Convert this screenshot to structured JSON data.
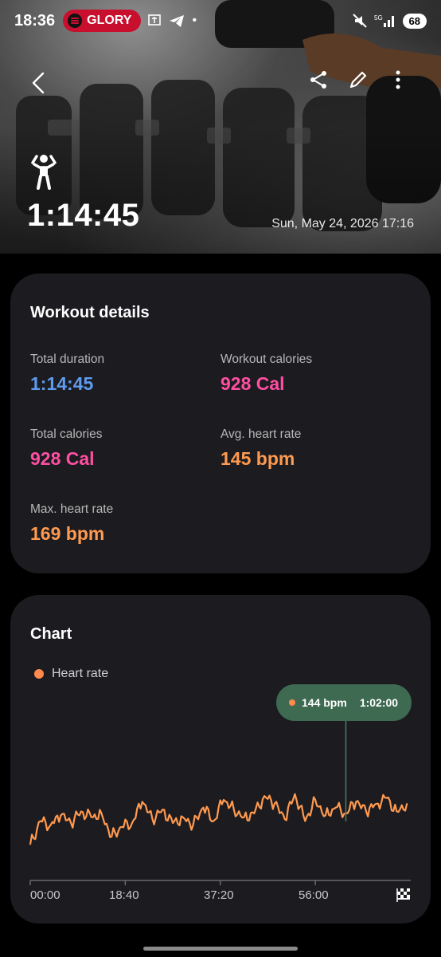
{
  "status_bar": {
    "time": "18:36",
    "spotify_label": "GLORY",
    "battery": "68"
  },
  "header": {
    "duration": "1:14:45",
    "date": "Sun, May 24, 2026 17:16"
  },
  "details": {
    "title": "Workout details",
    "stats": [
      {
        "label": "Total duration",
        "value": "1:14:45"
      },
      {
        "label": "Workout calories",
        "value": "928 Cal"
      },
      {
        "label": "Total calories",
        "value": "928 Cal"
      },
      {
        "label": "Avg. heart rate",
        "value": "145 bpm"
      },
      {
        "label": "Max. heart rate",
        "value": "169 bpm"
      }
    ]
  },
  "chart": {
    "title": "Chart",
    "legend": "Heart rate",
    "tooltip_value": "144 bpm",
    "tooltip_time": "1:02:00"
  },
  "colors": {
    "duration_blue": "#5e9bf0",
    "calories_pink": "#ff4fa3",
    "heart_orange": "#ff9a50",
    "tooltip_green": "#3e6a52",
    "card_bg": "#1c1b1f"
  },
  "chart_data": {
    "type": "line",
    "xlabel": "",
    "ylabel": "",
    "x_ticks": [
      "00:00",
      "18:40",
      "37:20",
      "56:00"
    ],
    "series": [
      {
        "name": "Heart rate",
        "x_minutes": [
          0,
          2,
          4,
          6,
          8,
          10,
          12,
          14,
          16,
          18,
          20,
          22,
          24,
          26,
          28,
          30,
          32,
          34,
          36,
          38,
          40,
          42,
          44,
          46,
          48,
          50,
          52,
          54,
          56,
          58,
          60,
          62,
          64,
          66,
          68,
          70,
          72,
          74
        ],
        "values": [
          128,
          140,
          138,
          143,
          139,
          145,
          142,
          144,
          132,
          137,
          139,
          150,
          141,
          146,
          139,
          142,
          138,
          147,
          140,
          151,
          146,
          142,
          144,
          153,
          149,
          141,
          154,
          140,
          151,
          143,
          147,
          144,
          150,
          145,
          149,
          152,
          145,
          149
        ]
      }
    ],
    "highlight": {
      "x": "1:02:00",
      "value": 144
    }
  }
}
